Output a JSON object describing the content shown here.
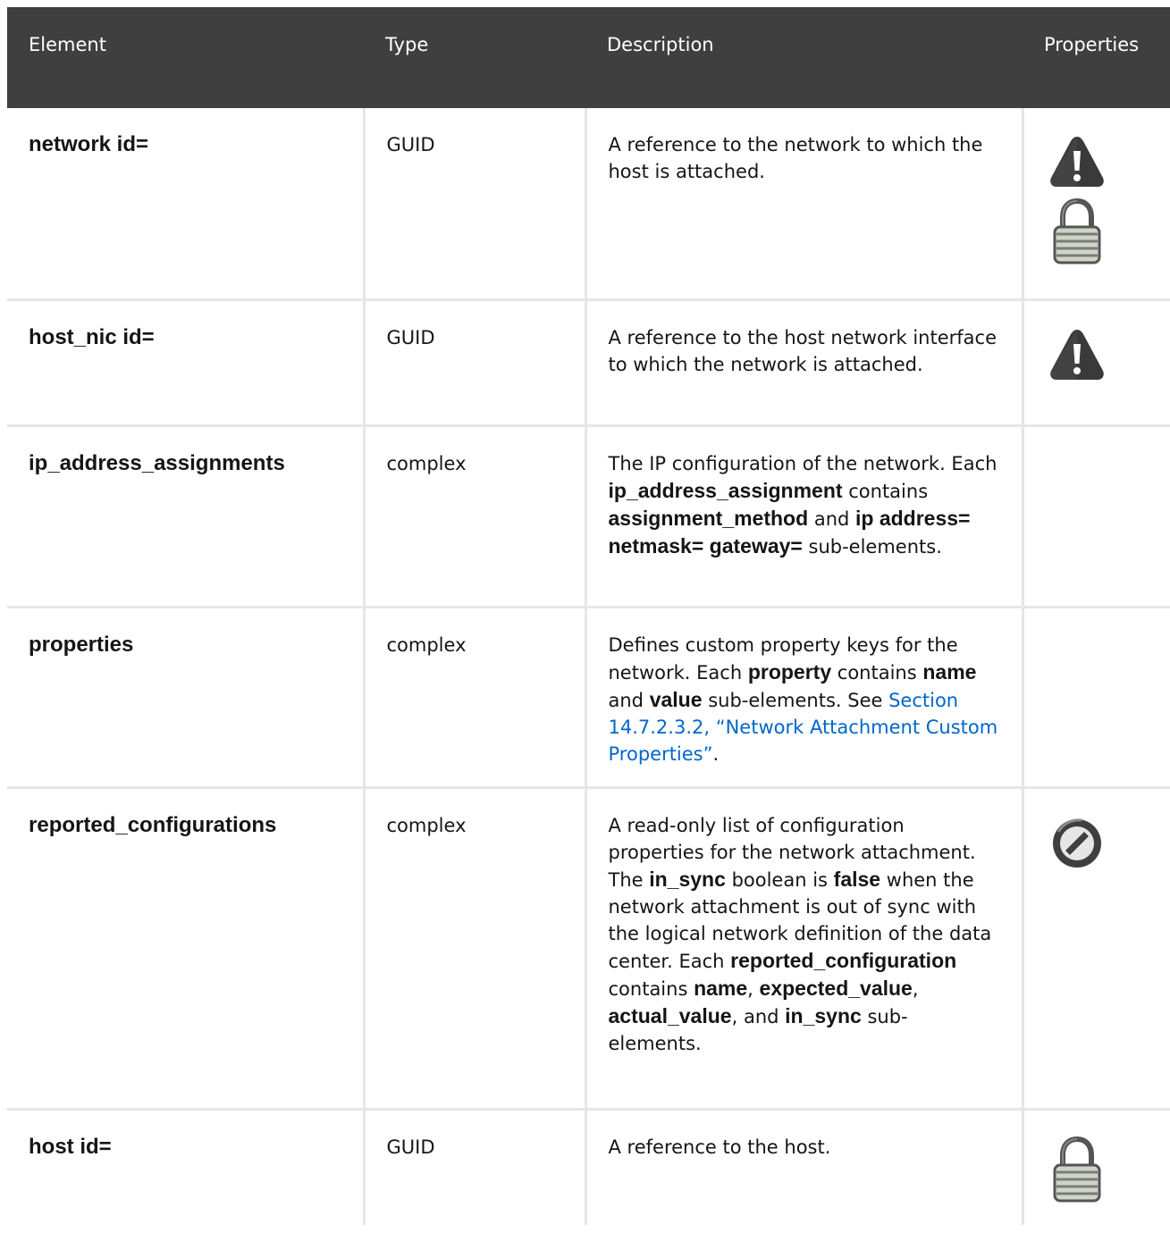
{
  "table": {
    "headers": [
      "Element",
      "Type",
      "Description",
      "Properties"
    ],
    "rows": [
      {
        "element": "network id=",
        "type": "GUID",
        "description_parts": [
          {
            "t": "text",
            "v": "A reference to the network to which the host is attached."
          }
        ],
        "icons": [
          "warning-icon",
          "lock-icon"
        ]
      },
      {
        "element": "host_nic id=",
        "type": "GUID",
        "description_parts": [
          {
            "t": "text",
            "v": "A reference to the host network interface to which the network is attached."
          }
        ],
        "icons": [
          "warning-icon"
        ]
      },
      {
        "element": "ip_address_assignments",
        "type": "complex",
        "description_parts": [
          {
            "t": "text",
            "v": "The IP configuration of the network. Each "
          },
          {
            "t": "bold",
            "v": "ip_address_assignment"
          },
          {
            "t": "text",
            "v": " contains "
          },
          {
            "t": "bold",
            "v": "assignment_method"
          },
          {
            "t": "text",
            "v": " and "
          },
          {
            "t": "bold",
            "v": "ip address= netmask= gateway="
          },
          {
            "t": "text",
            "v": " sub-elements."
          }
        ],
        "icons": []
      },
      {
        "element": "properties",
        "type": "complex",
        "description_parts": [
          {
            "t": "text",
            "v": "Defines custom property keys for the network. Each "
          },
          {
            "t": "bold",
            "v": "property"
          },
          {
            "t": "text",
            "v": " contains "
          },
          {
            "t": "bold",
            "v": "name"
          },
          {
            "t": "text",
            "v": " and "
          },
          {
            "t": "bold",
            "v": "value"
          },
          {
            "t": "text",
            "v": " sub-elements. See "
          },
          {
            "t": "link",
            "v": "Section 14.7.2.3.2, “Network Attachment Custom Properties”"
          },
          {
            "t": "text",
            "v": "."
          }
        ],
        "icons": []
      },
      {
        "element": "reported_configurations",
        "type": "complex",
        "description_parts": [
          {
            "t": "text",
            "v": "A read-only list of configuration properties for the network attachment. The "
          },
          {
            "t": "bold",
            "v": "in_sync"
          },
          {
            "t": "text",
            "v": " boolean is "
          },
          {
            "t": "bold",
            "v": "false"
          },
          {
            "t": "text",
            "v": " when the network attachment is out of sync with the logical network definition of the data center. Each "
          },
          {
            "t": "bold",
            "v": "reported_configuration"
          },
          {
            "t": "text",
            "v": " contains "
          },
          {
            "t": "bold",
            "v": "name"
          },
          {
            "t": "text",
            "v": ", "
          },
          {
            "t": "bold",
            "v": "expected_value"
          },
          {
            "t": "text",
            "v": ", "
          },
          {
            "t": "bold",
            "v": "actual_value"
          },
          {
            "t": "text",
            "v": ", and "
          },
          {
            "t": "bold",
            "v": "in_sync"
          },
          {
            "t": "text",
            "v": " sub-elements."
          }
        ],
        "icons": [
          "read-only-icon"
        ]
      },
      {
        "element": "host id=",
        "type": "GUID",
        "description_parts": [
          {
            "t": "text",
            "v": "A reference to the host."
          }
        ],
        "icons": [
          "lock-icon"
        ]
      }
    ]
  }
}
